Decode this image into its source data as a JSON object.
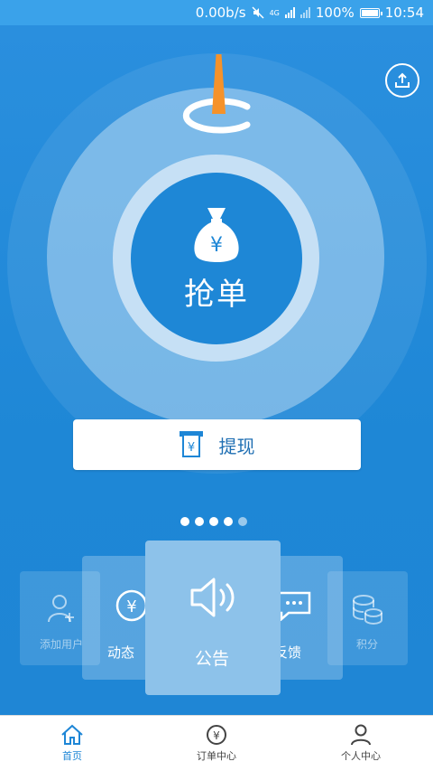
{
  "status_bar": {
    "speed": "0.00b/s",
    "network": "4G",
    "battery": "100%",
    "time": "10:54"
  },
  "main": {
    "grab_label": "抢单",
    "withdraw_label": "提现",
    "pager": {
      "total": 5,
      "active": 4
    }
  },
  "carousel": [
    {
      "label": "添加用户",
      "icon": "add-user-icon"
    },
    {
      "label": "动态",
      "icon": "yen-circle-icon"
    },
    {
      "label": "公告",
      "icon": "speaker-icon"
    },
    {
      "label": "反馈",
      "icon": "chat-bubble-icon"
    },
    {
      "label": "积分",
      "icon": "coin-stack-icon"
    }
  ],
  "tab_bar": [
    {
      "label": "首页",
      "icon": "home-icon",
      "active": true
    },
    {
      "label": "订单中心",
      "icon": "order-icon",
      "active": false
    },
    {
      "label": "个人中心",
      "icon": "person-icon",
      "active": false
    }
  ],
  "colors": {
    "primary": "#1e86d6",
    "status_bar": "#3aa2ea",
    "needle": "#f5922a"
  }
}
